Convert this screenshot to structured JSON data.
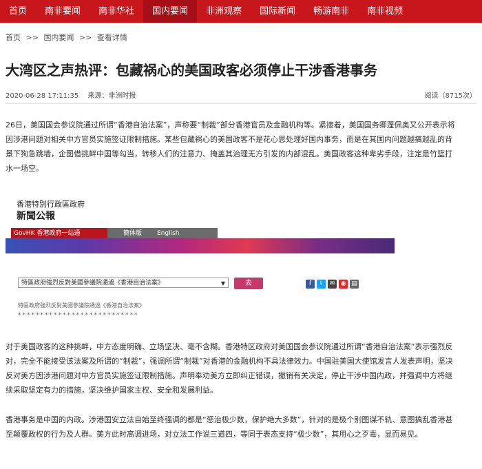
{
  "nav": {
    "items": [
      "首页",
      "南非要闻",
      "南非华社",
      "国内要闻",
      "非洲观察",
      "国际新闻",
      "畅游南非",
      "南非视频"
    ],
    "active_index": 3
  },
  "breadcrumb": {
    "home": "首页",
    "sep1": ">>",
    "section": "国内要闻",
    "sep2": ">>",
    "current": "查看详情"
  },
  "article": {
    "title": "大湾区之声热评：包藏祸心的美国政客必须停止干涉香港事务",
    "date": "2020-06-28 17:11:35",
    "source": "来源：非洲时报",
    "reads": "阅读（8715次）",
    "paragraphs": [
      "26日，美国国会参议院通过所谓“香港自治法案”，声称要“制裁”部分香港官员及金融机构等。紧接着，美国国务卿蓬佩奥又公开表示将因涉港问题对相关中方官员实施签证限制措施。某些包藏祸心的美国政客不是花心思处理好国内事务，而是在其国内问题越搞越乱的背景下狗急跳墙，企图借挑衅中国等勾当，转移人们的注意力、掩盖其治理无方引发的内部混乱。美国政客这种卑劣手段，注定是竹篮打水一场空。",
      "对于美国政客的这种挑衅，中方态度明确、立场坚决、毫不含糊。香港特区政府对美国国会参议院通过所谓“香港自治法案”表示强烈反对，完全不能接受该法案及所谓的“制裁”，强调所谓“制裁”对香港的金融机构不具法律效力。中国驻美国大使馆发言人发表声明，坚决反对美方因涉港问题对中方官员实施签证限制措施。声明奉劝美方立即纠正错误，撤销有关决定，停止干涉中国内政，并强调中方将继续采取坚定有力的措施，坚决维护国家主权、安全和发展利益。",
      "香港事务是中国的内政。涉港国安立法自始至终强调的都是“惩治极少数，保护绝大多数”，针对的是极个别图谋不轨、意图搞乱香港甚至颠覆政权的行为及人群。美方此时高调进场，对立法工作说三道四，等同于表态支持“极少数”，其用心之歹毒，显而易见。"
    ]
  },
  "embed": {
    "org": "香港特別行政區政府",
    "name": "新聞公報",
    "gov_link": "GovHK 香港政府一站通",
    "trad": "簡体版",
    "eng": "English",
    "select_value": "特區政府強烈反對美國參議院通過《香港自治法案》",
    "go_label": "去",
    "caption": "特區政府強烈反對美國參議院通過《香港自治法案》",
    "stars": "***************************",
    "colors": {
      "brand_red": "#c8161d",
      "go_button": "#c43a6a"
    }
  }
}
